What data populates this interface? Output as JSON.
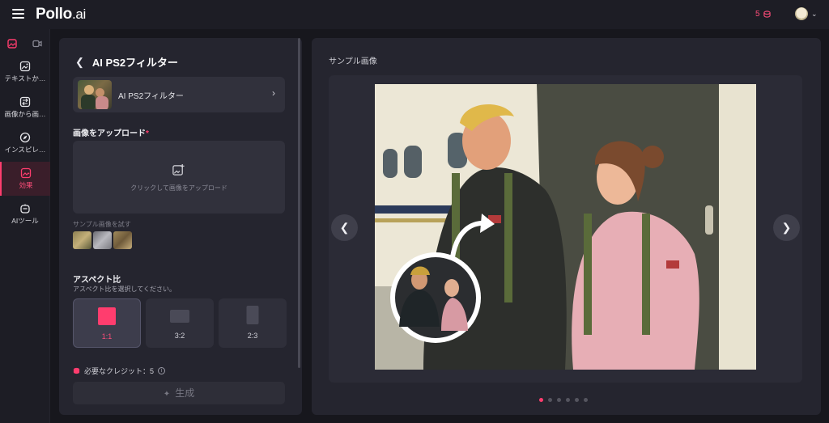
{
  "app": {
    "logo_main": "Pollo",
    "logo_tld": ".ai",
    "credits_count": "5"
  },
  "sidebar": {
    "items": [
      {
        "label": "テキストか…",
        "icon": "image-spark-icon"
      },
      {
        "label": "画像から画…",
        "icon": "image-to-image-icon"
      },
      {
        "label": "インスピレ…",
        "icon": "compass-icon"
      },
      {
        "label": "効果",
        "icon": "effects-icon"
      },
      {
        "label": "AIツール",
        "icon": "ai-tool-icon"
      }
    ]
  },
  "panel": {
    "back_title": "AI PS2フィルター",
    "filter_card_label": "AI PS2フィルター",
    "upload_label": "画像をアップロード",
    "required_mark": "*",
    "upload_hint": "クリックして画像をアップロード",
    "sample_label": "サンプル画像を試す",
    "aspect_title": "アスペクト比",
    "aspect_subtitle": "アスペクト比を選択してください。",
    "aspect_options": [
      "1:1",
      "3:2",
      "2:3"
    ],
    "aspect_selected": "1:1",
    "credits_label": "必要なクレジット：5",
    "generate_label": "生成"
  },
  "preview": {
    "title": "サンプル画像",
    "dots_count": 6,
    "active_dot": 0
  },
  "colors": {
    "accent": "#ff3d6e",
    "panel_bg": "#25252f",
    "page_bg": "#17171d"
  }
}
